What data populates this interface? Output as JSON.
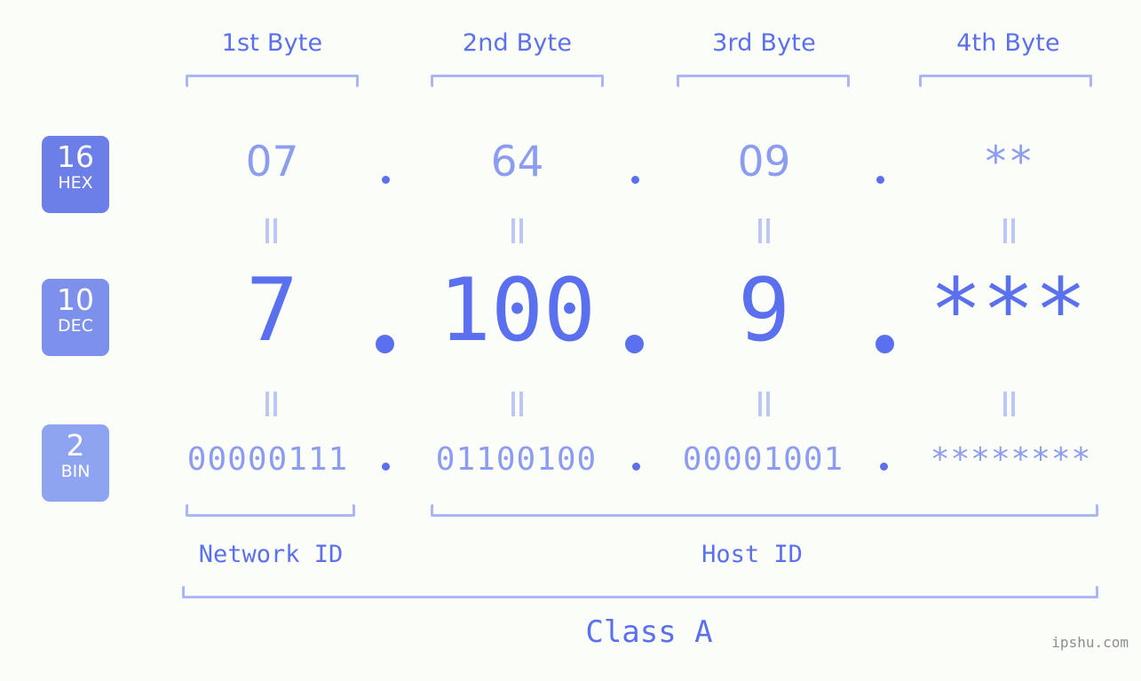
{
  "meta": {
    "watermark": "ipshu.com",
    "background_color": "#fbfdf8",
    "accent_color": "#5a70ee",
    "accent_light_color": "#8c9cf0",
    "bracket_color": "#aab6f5"
  },
  "headers": [
    {
      "label": "1st Byte"
    },
    {
      "label": "2nd Byte"
    },
    {
      "label": "3rd Byte"
    },
    {
      "label": "4th Byte"
    }
  ],
  "bases": [
    {
      "number": "16",
      "name": "HEX",
      "color": "#6c7fe8"
    },
    {
      "number": "10",
      "name": "DEC",
      "color": "#7d91ec"
    },
    {
      "number": "2",
      "name": "BIN",
      "color": "#8ea4f0"
    }
  ],
  "rows": {
    "hex": {
      "base": "16",
      "values": [
        "07",
        "64",
        "09",
        "**"
      ]
    },
    "dec": {
      "base": "10",
      "values": [
        "7",
        "100",
        "9",
        "***"
      ]
    },
    "bin": {
      "base": "2",
      "values": [
        "00000111",
        "01100100",
        "00001001",
        "********"
      ]
    }
  },
  "separators": {
    "symbol": "."
  },
  "equality": {
    "symbol": "||"
  },
  "sections": [
    {
      "label": "Network ID"
    },
    {
      "label": "Host ID"
    }
  ],
  "class": {
    "label": "Class A"
  }
}
